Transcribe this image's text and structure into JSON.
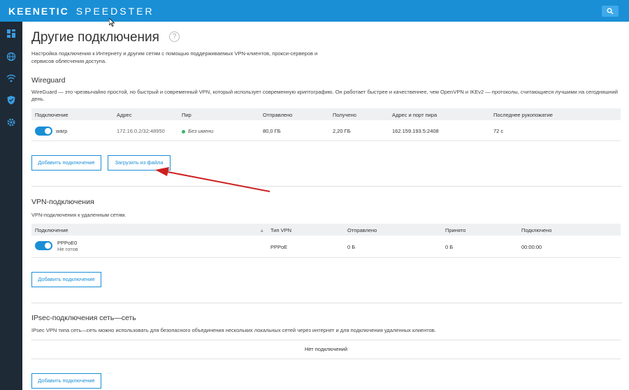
{
  "header": {
    "brand": "KEENETIC",
    "model": "SPEEDSTER",
    "brand_color": "#1a8fd6"
  },
  "sidebar": {
    "icons": [
      "dashboard-icon",
      "globe-icon",
      "wifi-icon",
      "shield-icon",
      "gear-icon"
    ]
  },
  "page": {
    "title": "Другие подключения",
    "help": "?",
    "description": "Настройка подключения к Интернету и другим сетям с помощью поддерживаемых VPN-клиентов, прокси-серверов и сервисов облесчения доступа."
  },
  "wireguard": {
    "title": "Wireguard",
    "text": "WireGuard — это чрезвычайно простой, но быстрый и современный VPN, который использует современную криптографию. Он работает быстрее и качественнее, чем OpenVPN и IKEv2 — протоколы, считающиеся лучшими на сегодняшний день.",
    "columns": [
      "Подключение",
      "Адрес",
      "Пир",
      "Отправлено",
      "Получено",
      "Адрес и порт пира",
      "Последнее рукопожатие"
    ],
    "rows": [
      {
        "name": "warp",
        "address": "172.16.0.2/32:48950",
        "peer": "Без имени",
        "sent": "80,0 ГБ",
        "received": "2,20 ГБ",
        "peer_addr": "162.159.193.5:2408",
        "handshake": "72 с"
      }
    ],
    "add_button": "Добавить подключение",
    "load_button": "Загрузить из файла"
  },
  "vpn": {
    "title": "VPN-подключения",
    "text": "VPN-подключения к удаленным сетям.",
    "columns": [
      "Подключение",
      "Тип VPN",
      "Отправлено",
      "Принято",
      "Подключено"
    ],
    "sort_indicator": "▲",
    "rows": [
      {
        "name": "PPPoE0",
        "status": "Не готов",
        "type": "PPPoE",
        "sent": "0 Б",
        "received": "0 Б",
        "connected": "00:00:00"
      }
    ],
    "add_button": "Добавить подключение"
  },
  "ipsec": {
    "title": "IPsec-подключения сеть—сеть",
    "text": "IPsec VPN типа сеть—сеть можно использовать для безопасного объединения нескольких локальных сетей через интернет и для подключения удаленных клиентов.",
    "empty": "Нет подключений",
    "add_button": "Добавить подключение"
  }
}
